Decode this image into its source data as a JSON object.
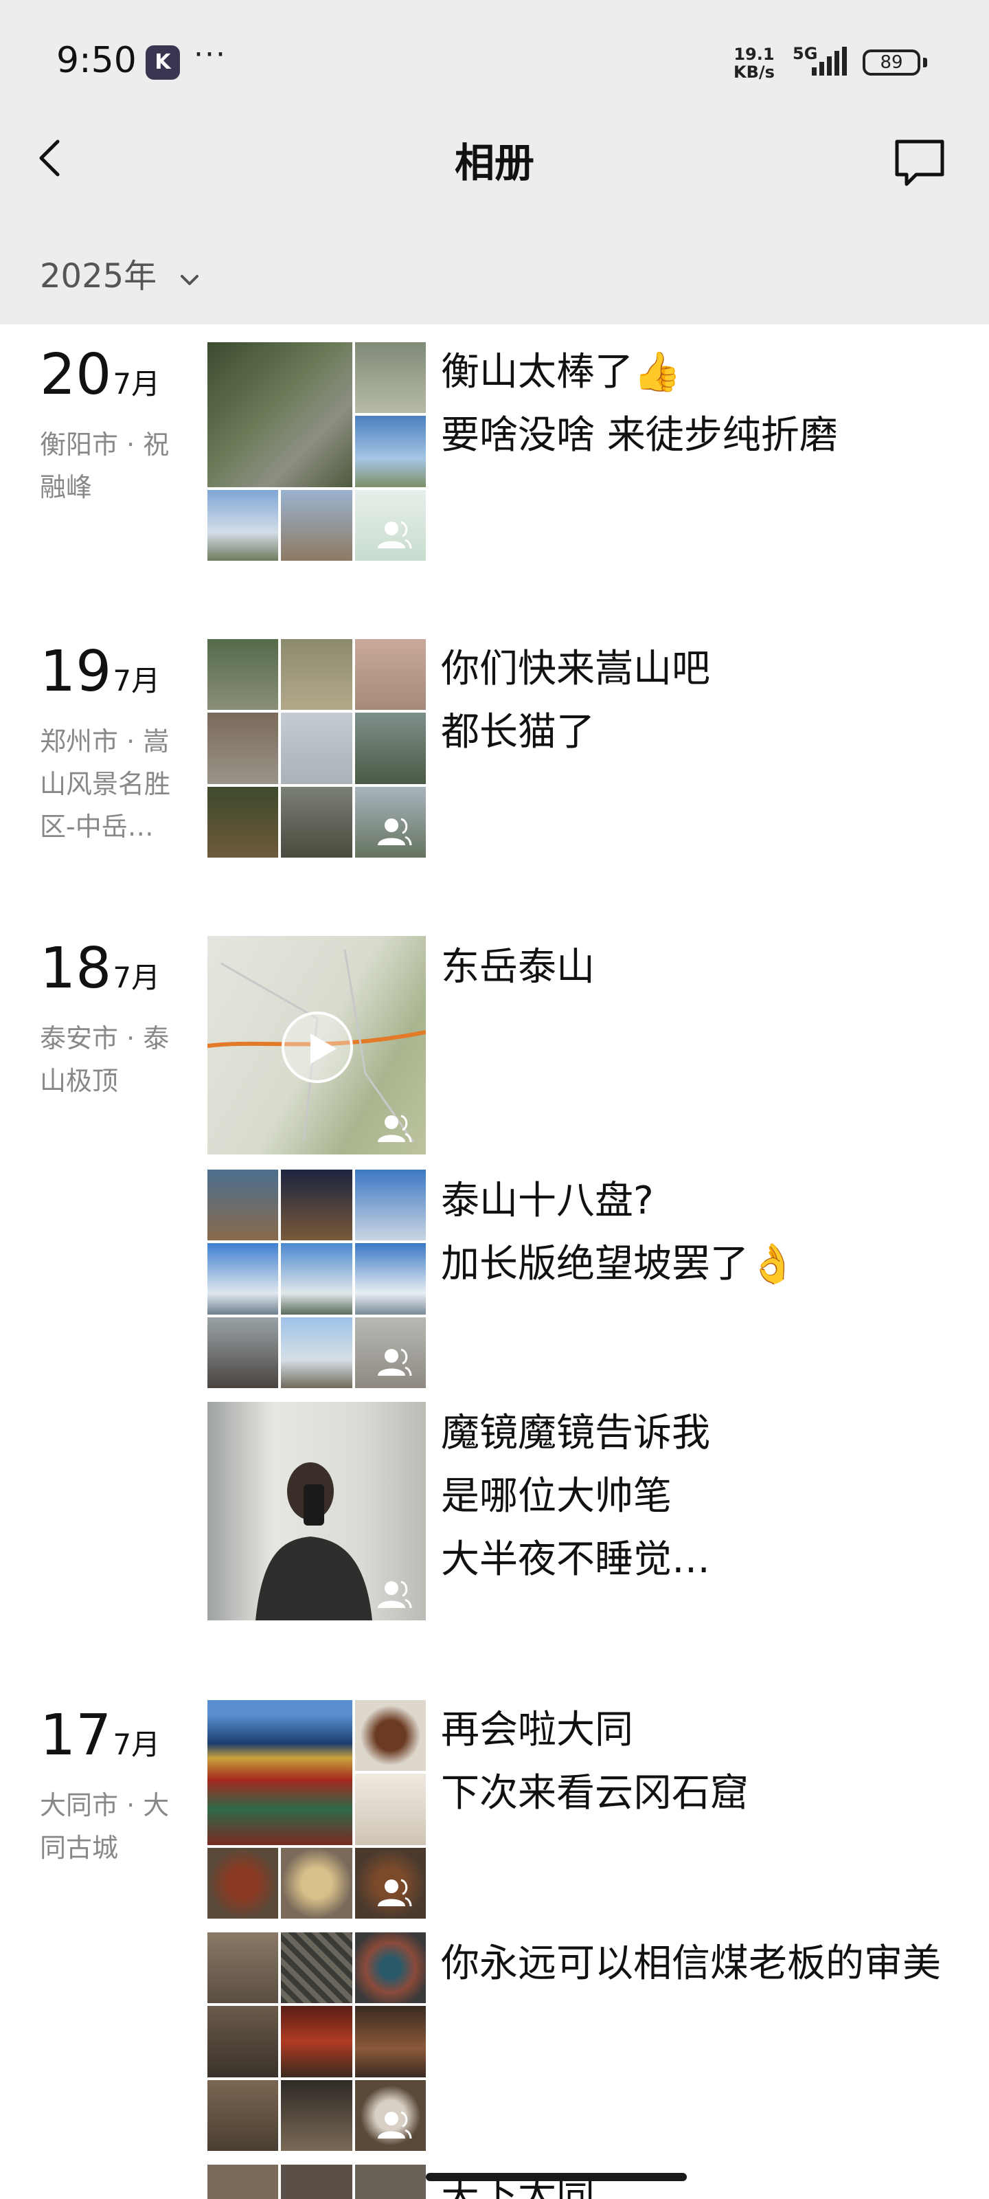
{
  "status_bar": {
    "time": "9:50",
    "app_badge": "K",
    "more": "···",
    "net_speed_value": "19.1",
    "net_speed_unit": "KB/s",
    "network": "5G",
    "battery": "89"
  },
  "navbar": {
    "title": "相册",
    "back_icon": "chevron-left-icon",
    "message_icon": "message-bubble-icon"
  },
  "year_selector": {
    "label": "2025年",
    "icon": "chevron-down-icon"
  },
  "days": [
    {
      "day": "20",
      "month": "7月",
      "location": "衡阳市 · 祝融峰",
      "posts": [
        {
          "caption_lines": [
            "衡山太棒了👍",
            "要啥没啥 来徒步纯折磨"
          ],
          "visibility_icon": "people-icon"
        }
      ]
    },
    {
      "day": "19",
      "month": "7月",
      "location": "郑州市 · 嵩山风景名胜区-中岳…",
      "posts": [
        {
          "caption_lines": [
            "你们快来嵩山吧",
            "都长猫了"
          ],
          "visibility_icon": "people-icon"
        }
      ]
    },
    {
      "day": "18",
      "month": "7月",
      "location": "泰安市 · 泰山极顶",
      "posts": [
        {
          "caption_lines": [
            "东岳泰山"
          ],
          "media": "video",
          "visibility_icon": "people-icon"
        },
        {
          "caption_lines": [
            "泰山十八盘?",
            "加长版绝望坡罢了👌"
          ],
          "visibility_icon": "people-icon"
        },
        {
          "caption_lines": [
            "魔镜魔镜告诉我",
            "是哪位大帅笔",
            "大半夜不睡觉…"
          ],
          "visibility_icon": "people-icon"
        }
      ]
    },
    {
      "day": "17",
      "month": "7月",
      "location": "大同市 · 大同古城",
      "posts": [
        {
          "caption_lines": [
            "再会啦大同",
            "下次来看云冈石窟"
          ],
          "visibility_icon": "people-icon"
        },
        {
          "caption_lines": [
            "你永远可以相信煤老板的审美"
          ],
          "visibility_icon": "people-icon"
        },
        {
          "caption_lines": [
            "天下大同"
          ],
          "visibility_icon": "people-icon"
        }
      ]
    }
  ],
  "colors": {
    "header_bg": "#ededed",
    "page_bg": "#ffffff",
    "secondary_text": "#888888"
  }
}
